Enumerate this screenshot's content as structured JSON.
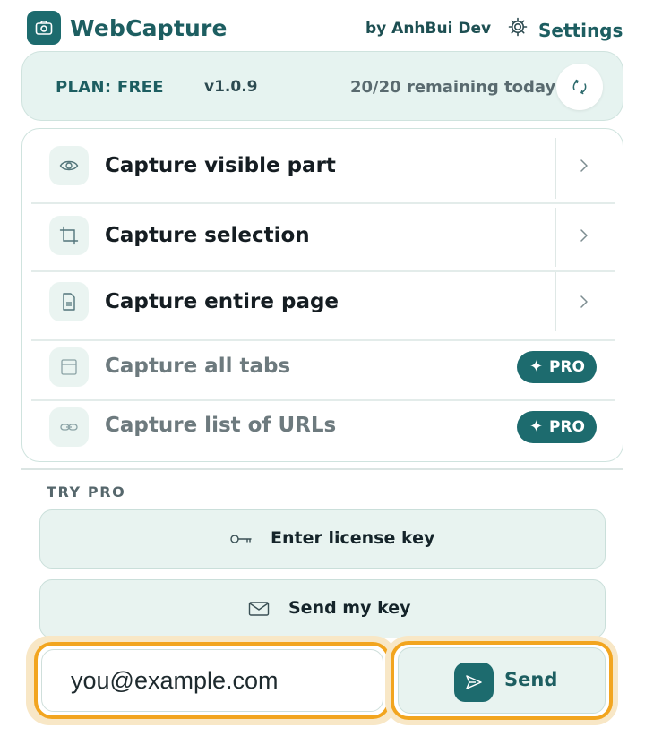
{
  "header": {
    "app_name": "WebCapture",
    "author": "by AnhBui Dev",
    "settings_label": "Settings",
    "logo_icon": "camera-icon",
    "settings_icon": "gear-icon"
  },
  "plan": {
    "plan_label": "PLAN: FREE",
    "version": "v1.0.9",
    "remaining": "20/20 remaining today",
    "refresh_icon": "refresh-icon"
  },
  "capture_options": [
    {
      "label": "Capture visible part",
      "icon": "eye-icon",
      "enabled": true
    },
    {
      "label": "Capture selection",
      "icon": "crop-icon",
      "enabled": true
    },
    {
      "label": "Capture entire page",
      "icon": "document-icon",
      "enabled": true
    },
    {
      "label": "Capture all tabs",
      "icon": "browser-window-icon",
      "enabled": false,
      "badge": "PRO",
      "badge_symbol": "✦"
    },
    {
      "label": "Capture list of URLs",
      "icon": "link-icon",
      "enabled": false,
      "badge": "PRO",
      "badge_symbol": "✦"
    }
  ],
  "try_pro": {
    "heading": "TRY PRO",
    "license_button": "Enter license key",
    "license_icon": "key-icon",
    "send_key_button": "Send my key",
    "send_key_icon": "mail-icon",
    "email_value": "you@example.com",
    "send_button": "Send",
    "send_icon": "send-icon"
  },
  "colors": {
    "brand": "#1d6b6e",
    "panel_bg": "#e6f3f0",
    "focus_ring": "#f2a51f",
    "muted_text": "#6d7a7e"
  }
}
